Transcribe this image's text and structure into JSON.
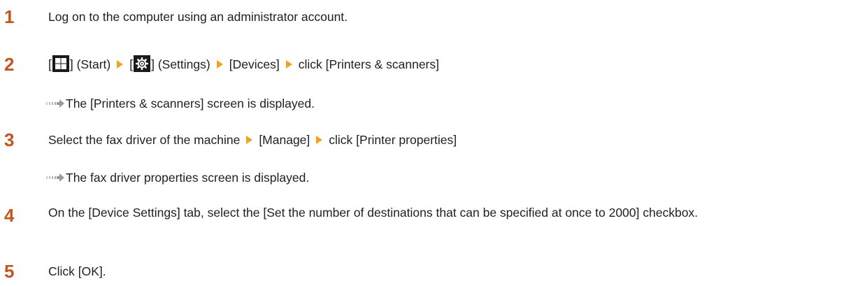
{
  "steps": [
    {
      "number": "1",
      "text": "Log on to the computer using an administrator account."
    },
    {
      "number": "2",
      "parts": {
        "start_label": "] (Start)",
        "settings_label": "] (Settings)",
        "devices": "[Devices]",
        "click_printers": "click [Printers & scanners]"
      },
      "icons": [
        "windows-start-icon",
        "settings-gear-icon"
      ],
      "result": "The [Printers & scanners] screen is displayed."
    },
    {
      "number": "3",
      "parts": {
        "select": "Select the fax driver of the machine",
        "manage": "[Manage]",
        "click_properties": "click [Printer properties]"
      },
      "result": "The fax driver properties screen is displayed."
    },
    {
      "number": "4",
      "text": "On the [Device Settings] tab, select the [Set the number of destinations that can be specified at once to 2000] checkbox."
    },
    {
      "number": "5",
      "text": "Click [OK]."
    }
  ],
  "colors": {
    "step_number": "#c1561f",
    "menu_arrow": "#f2a31b",
    "text": "#1f1f1f",
    "result_arrow": "#a0a0a0"
  }
}
